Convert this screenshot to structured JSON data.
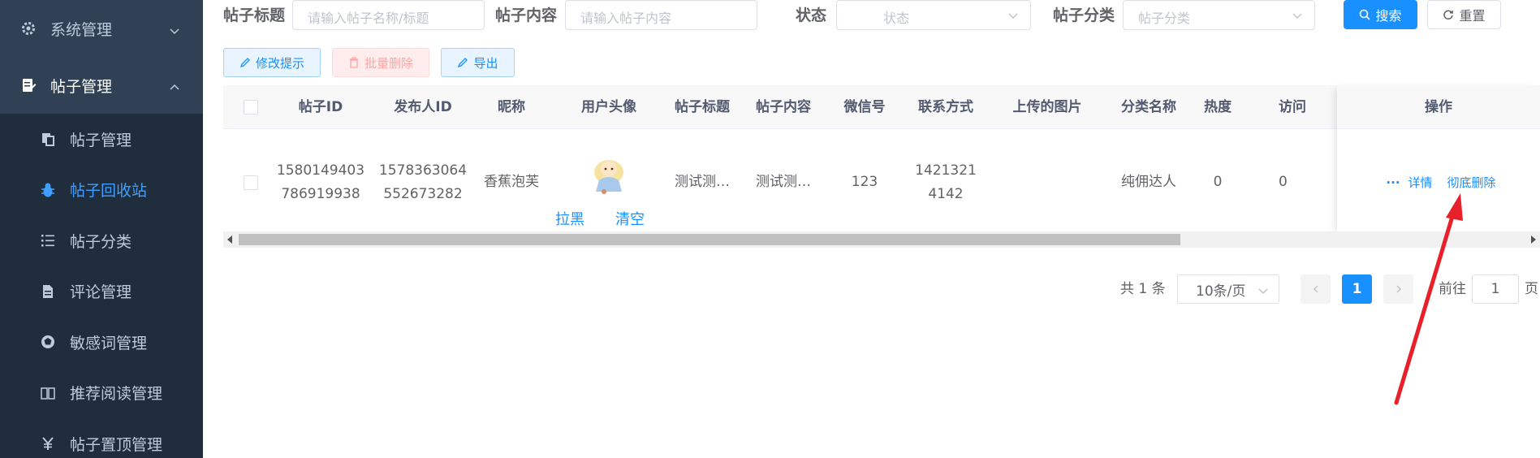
{
  "sidebar": {
    "items": [
      {
        "label": "系统管理",
        "icon": "gear-icon",
        "expanded": false
      },
      {
        "label": "帖子管理",
        "icon": "post-doc-icon",
        "expanded": true
      }
    ],
    "subitems": [
      {
        "label": "帖子管理",
        "icon": "copy-icon",
        "active": false
      },
      {
        "label": "帖子回收站",
        "icon": "bug-icon",
        "active": true
      },
      {
        "label": "帖子分类",
        "icon": "list-icon",
        "active": false
      },
      {
        "label": "评论管理",
        "icon": "document-icon",
        "active": false
      },
      {
        "label": "敏感词管理",
        "icon": "aperture-icon",
        "active": false
      },
      {
        "label": "推荐阅读管理",
        "icon": "book-icon",
        "active": false
      },
      {
        "label": "帖子置顶管理",
        "icon": "yen-icon",
        "active": false
      }
    ]
  },
  "search": {
    "title_label": "帖子标题",
    "title_placeholder": "请输入帖子名称/标题",
    "content_label": "帖子内容",
    "content_placeholder": "请输入帖子内容",
    "status_label": "状态",
    "status_placeholder": "状态",
    "category_label": "帖子分类",
    "category_placeholder": "帖子分类",
    "search_button": "搜索",
    "reset_button": "重置"
  },
  "toolbar": {
    "edit_tip": "修改提示",
    "batch_delete": "批量删除",
    "export": "导出"
  },
  "table": {
    "headers": [
      "帖子ID",
      "发布人ID",
      "昵称",
      "用户头像",
      "帖子标题",
      "帖子内容",
      "微信号",
      "联系方式",
      "上传的图片",
      "分类名称",
      "热度",
      "访问",
      "操作"
    ],
    "row": {
      "post_id_line1": "1580149403",
      "post_id_line2": "786919938",
      "publisher_id_line1": "1578363064",
      "publisher_id_line2": "552673282",
      "nickname": "香蕉泡芙",
      "block_link": "拉黑",
      "clear_link": "清空",
      "title": "测试测…",
      "content": "测试测…",
      "wechat": "123",
      "contact_line1": "1421321",
      "contact_line2": "4142",
      "category": "纯佣达人",
      "heat": "0",
      "visits": "0",
      "details": "详情",
      "delete_forever": "彻底删除"
    }
  },
  "pagination": {
    "total": "共 1 条",
    "page_size": "10条/页",
    "current_page": "1",
    "goto_label": "前往",
    "goto_value": "1",
    "page_suffix": "页"
  },
  "colors": {
    "sidebar_bg": "#304156",
    "submenu_bg": "#1f2d3d",
    "primary": "#1890ff",
    "annotation_arrow": "#e8202a"
  }
}
